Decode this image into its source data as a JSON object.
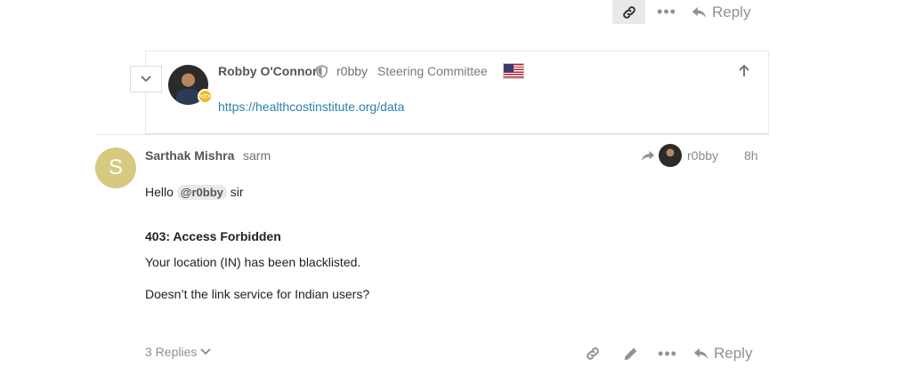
{
  "top_actions": {
    "reply_label": "Reply"
  },
  "embedded_post": {
    "author_name": "Robby O'Connor",
    "username": "r0bby",
    "user_title": "Steering Committee",
    "link_text": "https://healthcostinstitute.org/data"
  },
  "post": {
    "author_initial": "S",
    "author_name": "Sarthak Mishra",
    "username": "sarm",
    "reply_to_username": "r0bby",
    "relative_date": "8h",
    "greeting_prefix": "Hello",
    "mention": "@r0bby",
    "greeting_suffix": "sir",
    "heading": "403: Access Forbidden",
    "line1": "Your location (IN) has been blacklisted.",
    "line2": "Doesn’t the link service for Indian users?",
    "replies_label": "3 Replies",
    "reply_label": "Reply"
  },
  "colors": {
    "avatar_s_bg": "#d6c980",
    "link": "#2b7fb0",
    "muted": "#919191",
    "flair": "#f1b91f"
  },
  "icons": [
    "link-icon",
    "more-dots-icon",
    "reply-icon",
    "chevron-down-icon",
    "shield-icon",
    "us-flag-icon",
    "arrow-up-icon",
    "share-arrow-icon",
    "pencil-icon"
  ]
}
